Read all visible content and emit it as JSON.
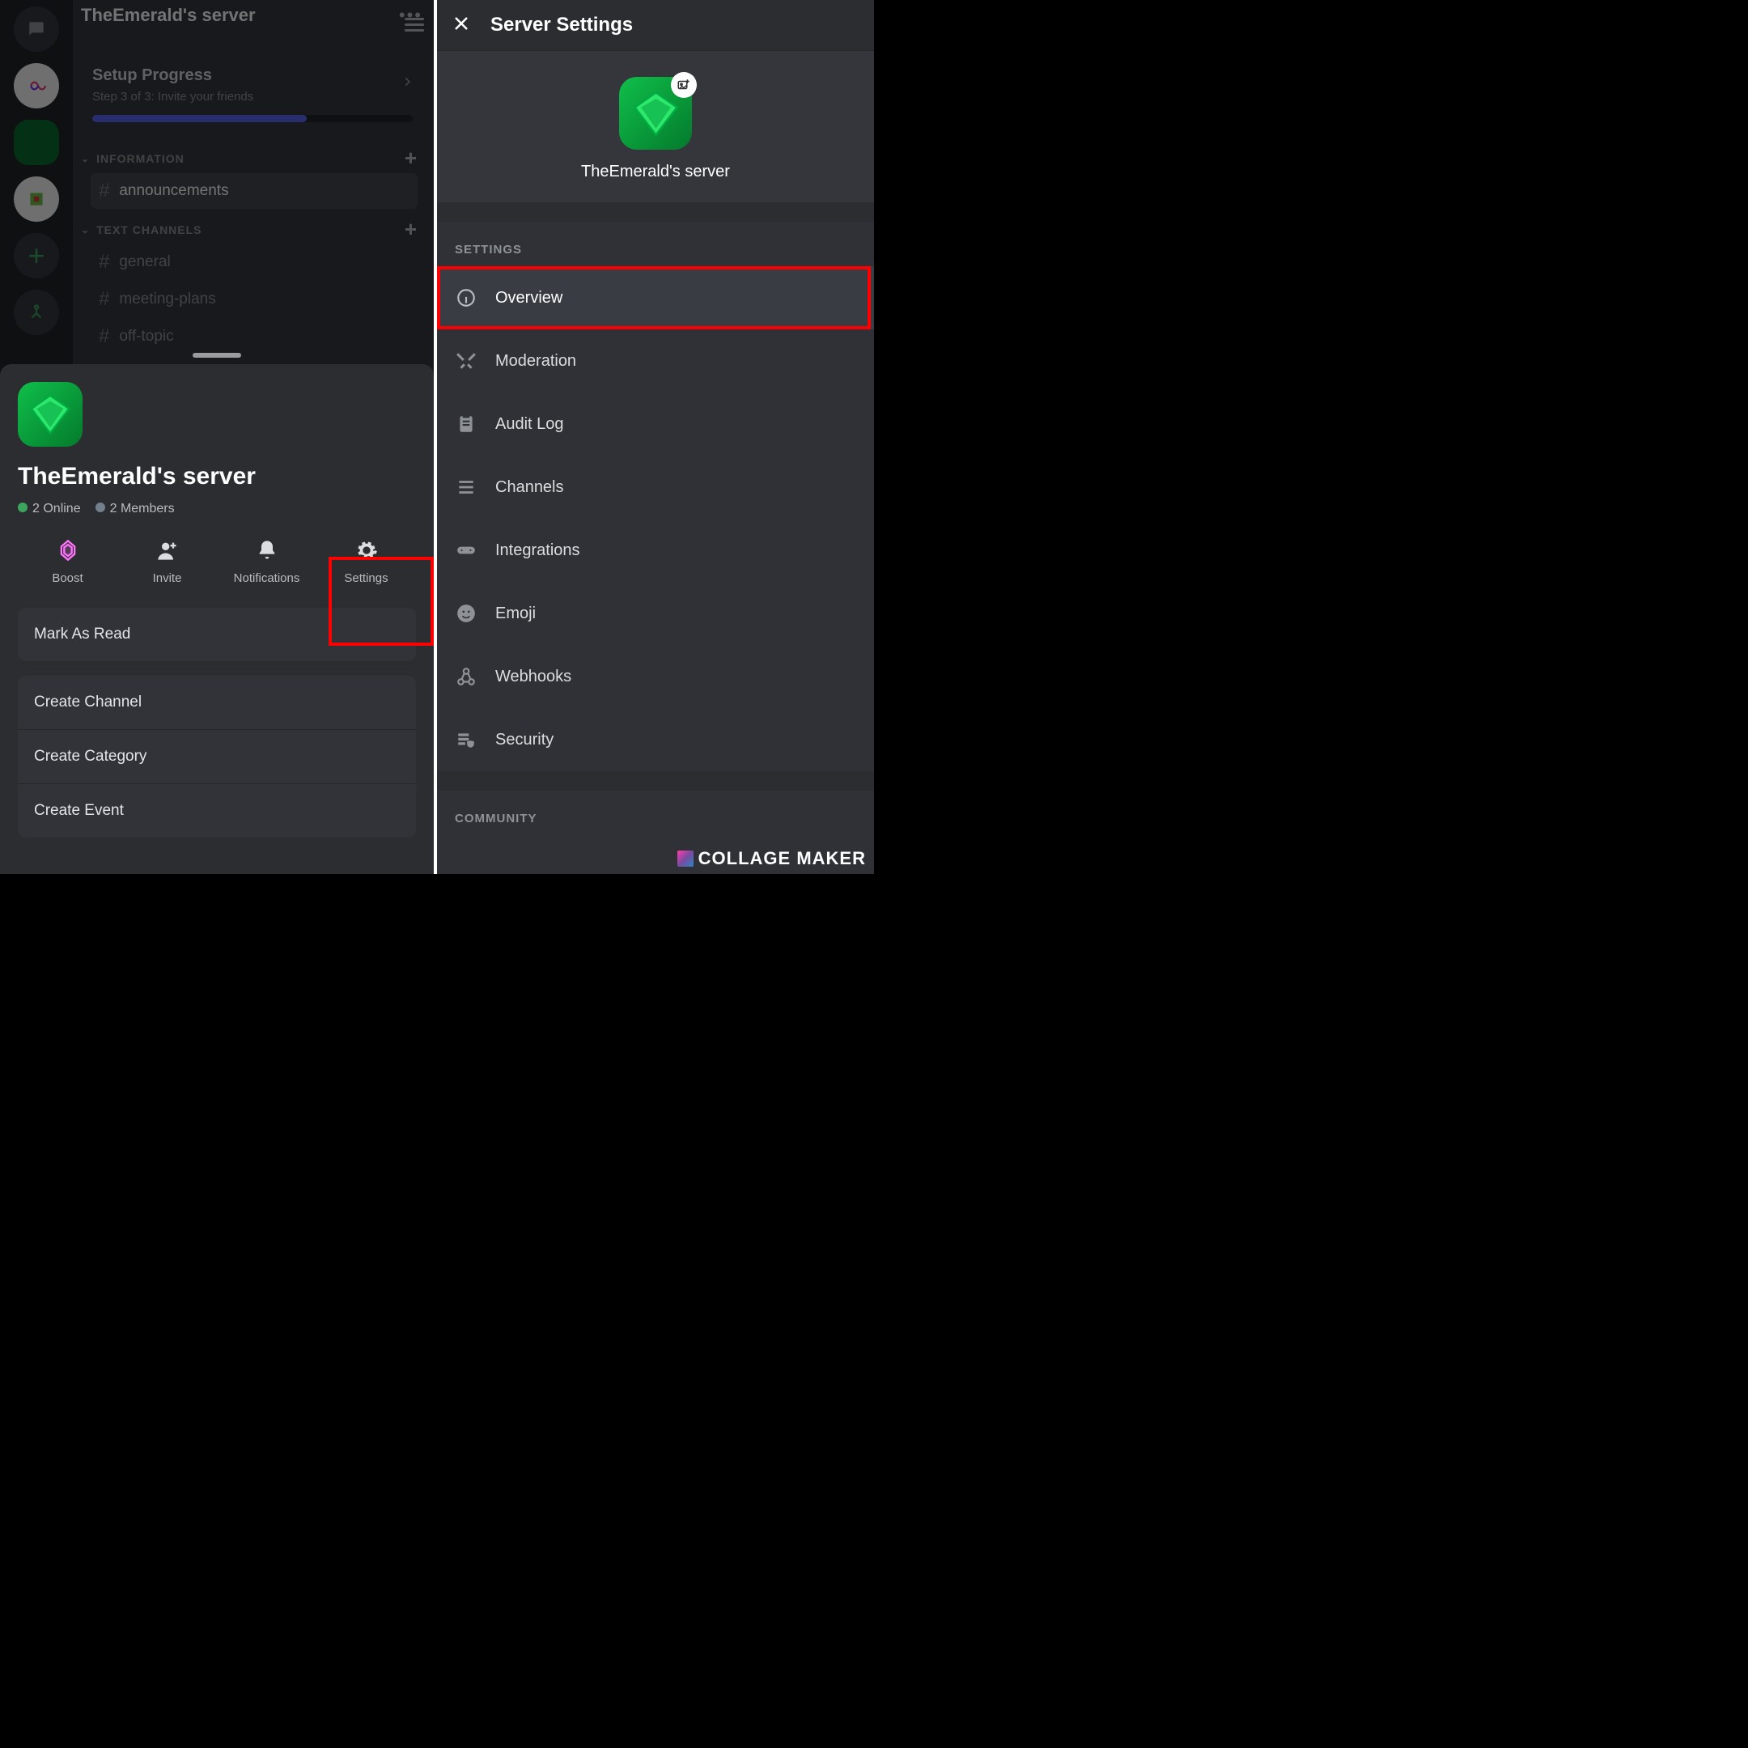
{
  "left": {
    "server_title": "TheEmerald's server",
    "setup": {
      "title": "Setup Progress",
      "subtitle": "Step 3 of 3: Invite your friends"
    },
    "categories": [
      {
        "name": "INFORMATION",
        "channels": [
          {
            "name": "announcements",
            "active": true
          }
        ]
      },
      {
        "name": "TEXT CHANNELS",
        "channels": [
          {
            "name": "general",
            "active": false
          },
          {
            "name": "meeting-plans",
            "active": false
          },
          {
            "name": "off-topic",
            "active": false
          }
        ]
      }
    ],
    "sheet": {
      "server_name": "TheEmerald's server",
      "online": "2 Online",
      "members": "2 Members",
      "actions": {
        "boost": "Boost",
        "invite": "Invite",
        "notifications": "Notifications",
        "settings": "Settings"
      },
      "list1": [
        "Mark As Read"
      ],
      "list2": [
        "Create Channel",
        "Create Category",
        "Create Event"
      ]
    }
  },
  "right": {
    "title": "Server Settings",
    "server_name": "TheEmerald's server",
    "section1": "SETTINGS",
    "items": [
      "Overview",
      "Moderation",
      "Audit Log",
      "Channels",
      "Integrations",
      "Emoji",
      "Webhooks",
      "Security"
    ],
    "section2": "COMMUNITY"
  },
  "watermark": "COLLAGE MAKER"
}
